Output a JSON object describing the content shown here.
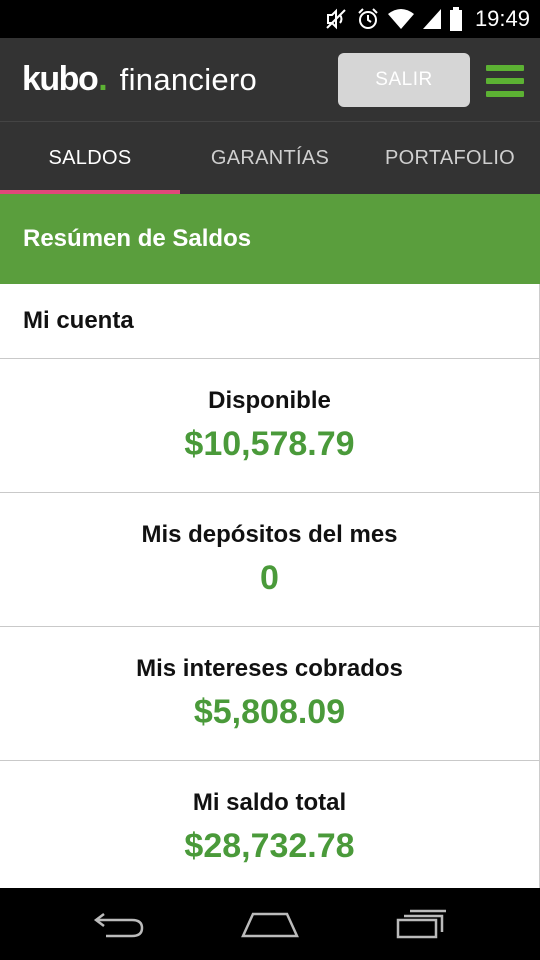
{
  "status_bar": {
    "time": "19:49",
    "icons": [
      "mute-icon",
      "alarm-icon",
      "wifi-icon",
      "signal-icon",
      "battery-icon"
    ]
  },
  "header": {
    "logo_brand": "kubo",
    "logo_dot": ".",
    "logo_suffix": "financiero",
    "logout_label": "SALIR",
    "menu_icon": "hamburger-menu-icon"
  },
  "tabs": [
    {
      "label": "SALDOS",
      "active": true
    },
    {
      "label": "GARANTÍAS",
      "active": false
    },
    {
      "label": "PORTAFOLIO",
      "active": false
    }
  ],
  "main": {
    "section_title": "Resúmen de Saldos",
    "account_heading": "Mi cuenta",
    "balances": [
      {
        "label": "Disponible",
        "value": "$10,578.79"
      },
      {
        "label": "Mis depósitos del mes",
        "value": "0"
      },
      {
        "label": "Mis intereses cobrados",
        "value": "$5,808.09"
      },
      {
        "label": "Mi saldo total",
        "value": "$28,732.78"
      }
    ]
  },
  "colors": {
    "header_bg": "#333333",
    "brand_green": "#5cb233",
    "section_green": "#5a9e3d",
    "value_green": "#4a9a3a",
    "tab_indicator": "#e0477a",
    "logout_button": "#d6d6d6"
  },
  "nav_bar": {
    "icons": [
      "back-icon",
      "home-icon",
      "recent-apps-icon"
    ]
  }
}
